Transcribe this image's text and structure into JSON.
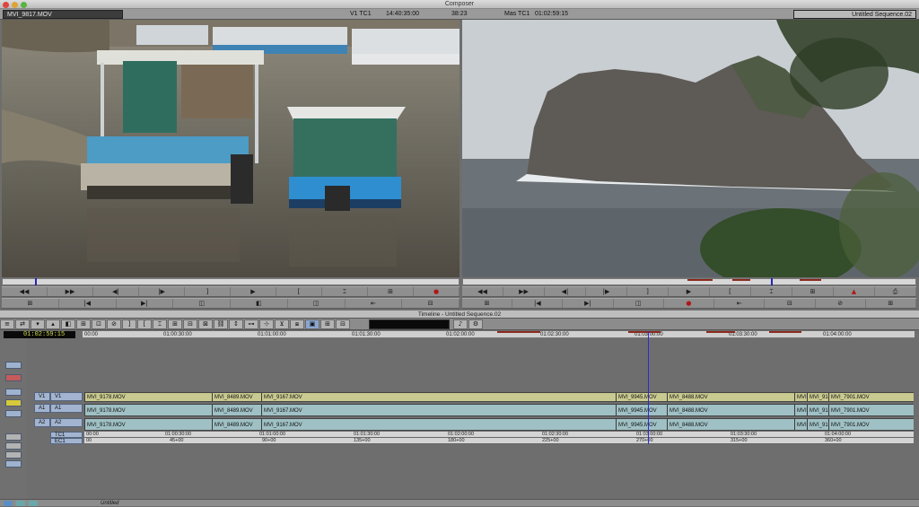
{
  "window": {
    "title": "Composer"
  },
  "header": {
    "source_clip": "MVI_9817.MOV",
    "track_tc_label": "V1 TC1",
    "track_tc_value": "14:40:35:00",
    "duration": "38:23",
    "mas_tc_label": "Mas TC1",
    "mas_tc_value": "01:02:59:15",
    "sequence_name": "Untitled Sequence.02"
  },
  "timeline": {
    "title": "Timeline - Untitled Sequence.02",
    "position_tc": "01:02:59:15",
    "ruler_labels": [
      "00:00",
      "01:00:30:00",
      "01:01:00:00",
      "01:01:30:00",
      "01:02:00:00",
      "01:02:30:00",
      "01:03:00:00",
      "01:03:30:00",
      "01:04:00:00"
    ],
    "tracks": {
      "v1": {
        "rec": "V1",
        "src": "V1"
      },
      "a1": {
        "rec": "A1",
        "src": "A1"
      },
      "a2": {
        "rec": "A2",
        "src": "A2"
      },
      "tc1": "TC1",
      "ec1": "EC1"
    },
    "video_clips": [
      "MVI_9178.MOV",
      "MVI_8489.MOV",
      "MVI_9167.MOV",
      "MVI_9945.MOV",
      "MVI_8488.MOV",
      "MVI",
      "MVI_91",
      "MVI_7901.MOV"
    ],
    "a1_clips": [
      "MVI_9178.MOV",
      "MVI_8489.MOV",
      "MVI_9167.MOV",
      "MVI_9945.MOV",
      "MVI_8488.MOV",
      "MVI",
      "MVI_91",
      "MVI_7901.MOV"
    ],
    "a2_clips": [
      "MVI_9178.MOV",
      "MVI_8489.MOV",
      "MVI_9167.MOV",
      "MVI_9945.MOV",
      "MVI_8488.MOV",
      "MVI",
      "MVI_91",
      "MVI_7901.MOV"
    ],
    "ec_labels": [
      "00",
      "45+00",
      "90+00",
      "135+00",
      "180+00",
      "225+00",
      "270+00",
      "315+00",
      "360+00"
    ]
  },
  "status": {
    "bin_label": "Untitled"
  }
}
